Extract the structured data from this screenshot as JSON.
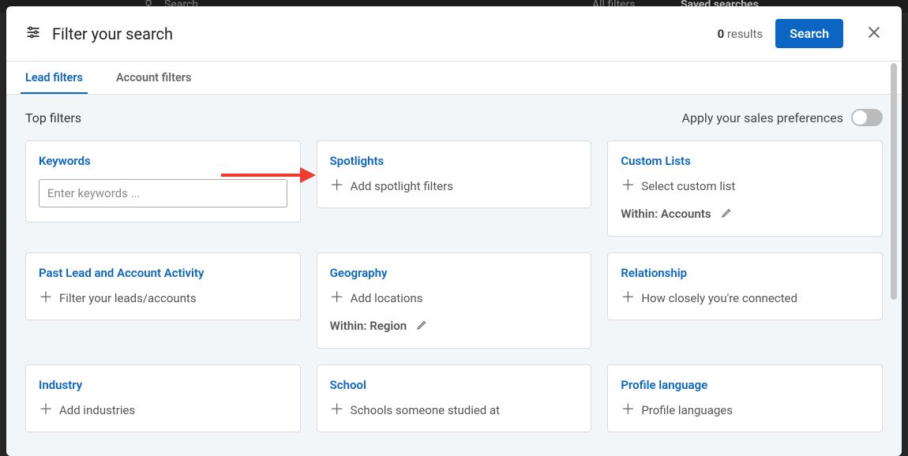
{
  "hidden_top": {
    "search": "Search",
    "all_filters": "All filters",
    "saved": "Saved searches"
  },
  "header": {
    "title": "Filter your search",
    "results_count": "0",
    "results_label": "results",
    "search_btn": "Search"
  },
  "tabs": {
    "lead": "Lead filters",
    "account": "Account filters"
  },
  "prefs": {
    "section_title": "Top filters",
    "apply_label": "Apply your sales preferences"
  },
  "cards": {
    "keywords": {
      "title": "Keywords",
      "placeholder": "Enter keywords ..."
    },
    "spotlights": {
      "title": "Spotlights",
      "action": "Add spotlight filters"
    },
    "custom_lists": {
      "title": "Custom Lists",
      "action": "Select custom list",
      "sub": "Within: Accounts"
    },
    "past_activity": {
      "title": "Past Lead and Account Activity",
      "action": "Filter your leads/accounts"
    },
    "geography": {
      "title": "Geography",
      "action": "Add locations",
      "sub": "Within: Region"
    },
    "relationship": {
      "title": "Relationship",
      "action": "How closely you're connected"
    },
    "industry": {
      "title": "Industry",
      "action": "Add industries"
    },
    "school": {
      "title": "School",
      "action": "Schools someone studied at"
    },
    "profile_lang": {
      "title": "Profile language",
      "action": "Profile languages"
    }
  }
}
